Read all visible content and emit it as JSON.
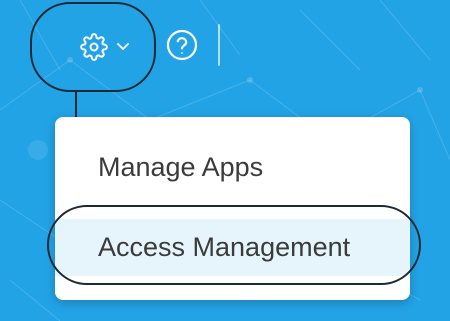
{
  "colors": {
    "background": "#22a3e6",
    "menu_background": "#ffffff",
    "menu_highlight": "#e6f4fb",
    "menu_text": "#3b3b3b",
    "icon_color": "#ffffff",
    "annotation_color": "#1e2a33"
  },
  "toolbar": {
    "settings_icon": "gear-icon",
    "settings_caret_icon": "chevron-down-icon",
    "help_icon": "question-circle-icon"
  },
  "settings_menu": {
    "items": [
      {
        "label": "Manage Apps"
      },
      {
        "label": "Access Management"
      }
    ]
  }
}
